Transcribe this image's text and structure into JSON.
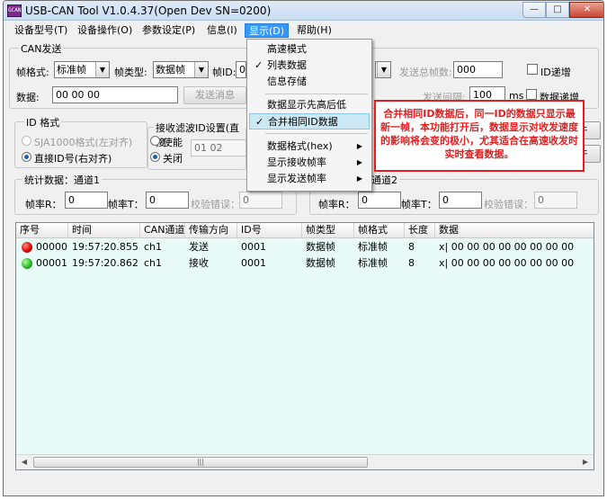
{
  "window": {
    "title": "USB-CAN Tool V1.0.4.37(Open Dev SN=0200)",
    "app_icon_text": "GCAN",
    "min_glyph": "—",
    "max_glyph": "□",
    "close_glyph": "✕"
  },
  "menubar": {
    "items": [
      {
        "label": "设备型号(T)"
      },
      {
        "label": "设备操作(O)"
      },
      {
        "label": "参数设定(P)"
      },
      {
        "label": "信息(I)"
      },
      {
        "label": "显示(D)"
      },
      {
        "label": "帮助(H)"
      }
    ]
  },
  "can_send": {
    "group_label": "CAN发送",
    "frame_format_label": "帧格式:",
    "frame_format_value": "标准帧",
    "frame_type_label": "帧类型:",
    "frame_type_value": "数据帧",
    "frame_id_label": "帧ID:",
    "frame_id_value": "0",
    "data_label": "数据:",
    "data_value": "00 00 00",
    "send_button": "发送消息",
    "total_send_label": "发送总帧数:",
    "total_send_value": "000",
    "id_increment_label": "ID递增",
    "interval_label": "发送间隔:",
    "interval_value": "100",
    "interval_unit": "ms",
    "data_increment_label": "数据递增"
  },
  "id_format": {
    "group_label": "ID 格式",
    "option_sja": "SJA1000格式(左对齐)",
    "option_direct": "直接ID号(右对齐)"
  },
  "filter": {
    "group_label": "接收滤波ID设置(直接",
    "enable_label": "使能",
    "disable_label": "关闭",
    "value": "01 02"
  },
  "side_buttons": {
    "top": "件",
    "bottom": "件"
  },
  "stats_left": {
    "group_label": "统计数据：通道1",
    "rate_r_label": "帧率R：",
    "rate_r_value": "0",
    "rate_t_label": "帧率T：",
    "rate_t_value": "0",
    "err_label": "校验错误：",
    "err_value": "0"
  },
  "stats_right": {
    "group_label": "通道2",
    "rate_r_label": "帧率R：",
    "rate_r_value": "0",
    "rate_t_label": "帧率T：",
    "rate_t_value": "0",
    "err_label": "校验错误：",
    "err_value": "0"
  },
  "table": {
    "columns": [
      "序号",
      "时间",
      "CAN通道",
      "传输方向",
      "ID号",
      "帧类型",
      "帧格式",
      "长度",
      "数据"
    ],
    "rows": [
      {
        "status": "red",
        "seq": "00000",
        "time": "19:57:20.855",
        "channel": "ch1",
        "direction": "发送",
        "id": "0001",
        "type": "数据帧",
        "format": "标准帧",
        "len": "8",
        "data": "x| 00 00 00 00 00 00 00 00"
      },
      {
        "status": "green",
        "seq": "00001",
        "time": "19:57:20.862",
        "channel": "ch1",
        "direction": "接收",
        "id": "0001",
        "type": "数据帧",
        "format": "标准帧",
        "len": "8",
        "data": "x| 00 00 00 00 00 00 00 00"
      }
    ],
    "scroll_thumb": "|||"
  },
  "display_menu": {
    "items": [
      {
        "label": "高速模式",
        "checked": false,
        "submenu": false
      },
      {
        "label": "列表数据",
        "checked": true,
        "submenu": false
      },
      {
        "label": "信息存储",
        "checked": false,
        "submenu": false
      },
      {
        "label": "数据显示先高后低",
        "checked": false,
        "submenu": false
      },
      {
        "label": "合并相同ID数据",
        "checked": true,
        "submenu": false
      },
      {
        "label": "数据格式(hex)",
        "checked": false,
        "submenu": true
      },
      {
        "label": "显示接收帧率",
        "checked": false,
        "submenu": true
      },
      {
        "label": "显示发送帧率",
        "checked": false,
        "submenu": true
      }
    ],
    "check_glyph": "✓",
    "submenu_glyph": "▶"
  },
  "callout": {
    "text": "合并相同ID数据后，同一ID的数据只显示最新一帧，本功能打开后，数据显示对收发速度的影响将会变的极小，尤其适合在高速收发时实时查看数据。"
  },
  "colors": {
    "menu_active": "#3399ff",
    "table_bg": "#e9fbf7",
    "callout": "#e02020",
    "menu_highlight": "#cce8f4"
  }
}
